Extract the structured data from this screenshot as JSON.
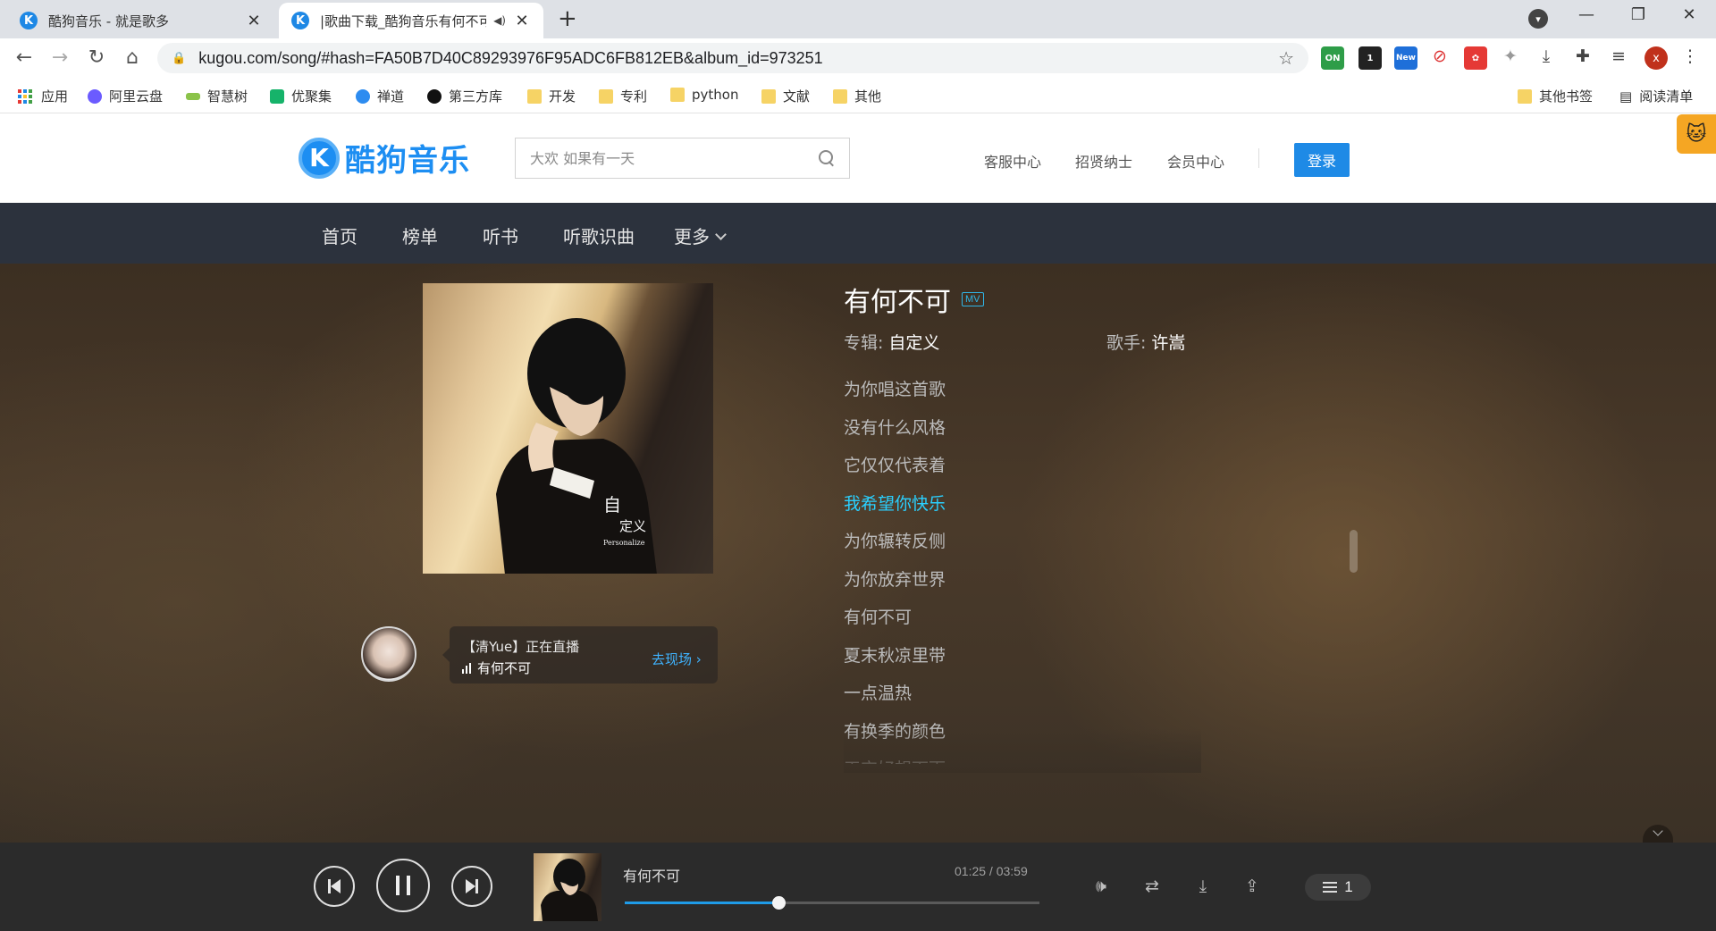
{
  "browser": {
    "tabs": [
      {
        "title": "酷狗音乐 - 就是歌多",
        "active": false
      },
      {
        "title": "|歌曲下载_酷狗音乐有何不可",
        "active": true
      }
    ],
    "url": "kugou.com/song/#hash=FA50B7D40C89293976F95ADC6FB812EB&album_id=973251",
    "extensions": {
      "ext1": "ON",
      "ext2": "1",
      "ext3": "New",
      "profile": "x"
    },
    "bookmarks": [
      {
        "label": "应用"
      },
      {
        "label": "阿里云盘"
      },
      {
        "label": "智慧树"
      },
      {
        "label": "优聚集"
      },
      {
        "label": "禅道"
      },
      {
        "label": "第三方库"
      },
      {
        "label": "开发"
      },
      {
        "label": "专利"
      },
      {
        "label": "python"
      },
      {
        "label": "文献"
      },
      {
        "label": "其他"
      }
    ],
    "bookmarks_right": {
      "other": "其他书签",
      "reading": "阅读清单"
    }
  },
  "header": {
    "logo_text": "酷狗音乐",
    "search_placeholder": "大欢 如果有一天",
    "links": [
      "客服中心",
      "招贤纳士",
      "会员中心"
    ],
    "login": "登录"
  },
  "nav": {
    "items": [
      "首页",
      "榜单",
      "听书",
      "听歌识曲",
      "更多"
    ]
  },
  "song": {
    "title": "有何不可",
    "mv_badge": "MV",
    "album_label": "专辑:",
    "album": "自定义",
    "singer_label": "歌手:",
    "singer": "许嵩",
    "cover_text": {
      "t1": "自",
      "t2": "定义",
      "t3": "Personalize"
    },
    "lyrics": [
      "为你唱这首歌",
      "没有什么风格",
      "它仅仅代表着",
      "我希望你快乐",
      "为你辗转反侧",
      "为你放弃世界",
      "有何不可",
      "夏末秋凉里带",
      "一点温热",
      "有换季的颜色",
      "天空好想下雨"
    ],
    "current_lyric_index": 3
  },
  "live": {
    "line1": "【清Yue】正在直播",
    "song": "有何不可",
    "go": "去现场"
  },
  "player": {
    "title": "有何不可",
    "time": "01:25 / 03:59",
    "progress": 0.37,
    "playlist_count": "1"
  },
  "colors": {
    "accent": "#1e8ae6",
    "lyric_current": "#2ad0ff",
    "progress": "#1f9be8",
    "nav_bg": "#2c323d",
    "playbar_bg": "#2b2b2b"
  }
}
